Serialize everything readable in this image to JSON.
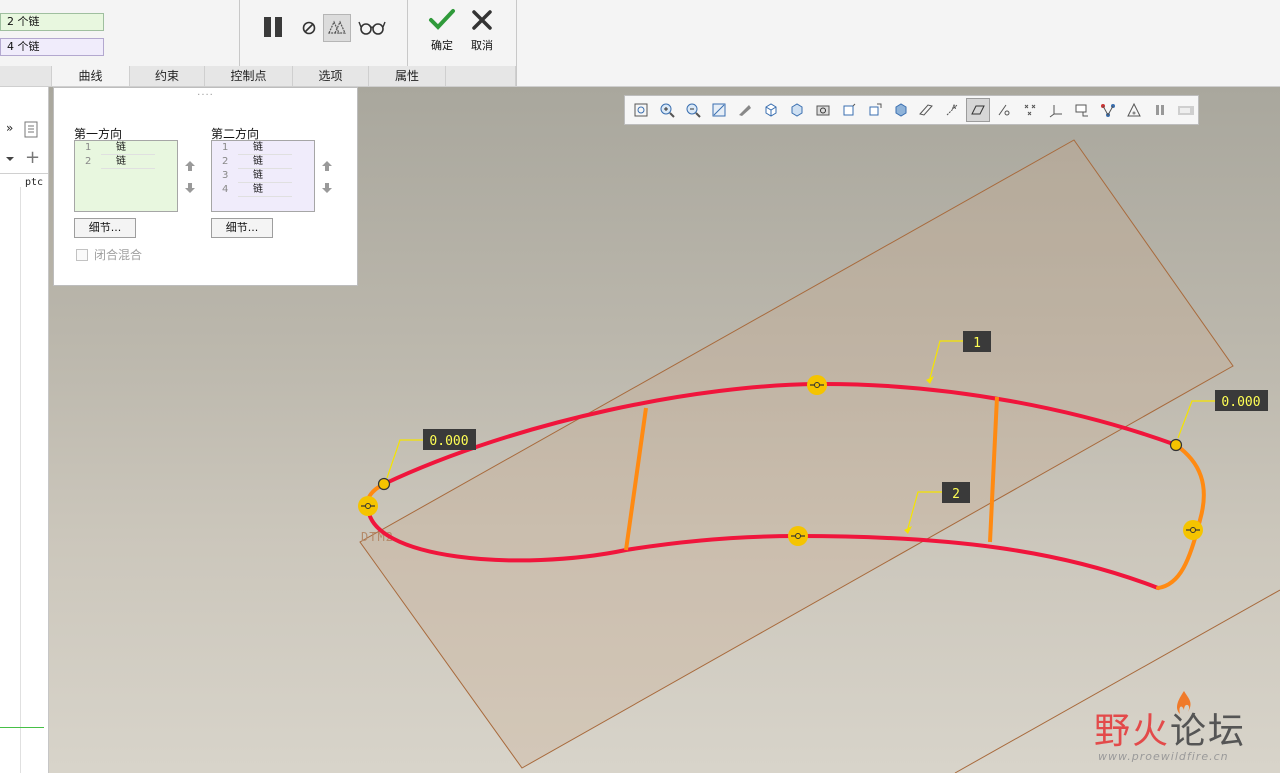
{
  "dashboard": {
    "first_direction_field": "2 个链",
    "second_direction_field": "4 个链",
    "tabs": [
      "曲线",
      "约束",
      "控制点",
      "选项",
      "属性"
    ],
    "active_tab": "曲线",
    "confirm_label": "确定",
    "cancel_label": "取消",
    "tool_icons": [
      "pause-icon",
      "stop-icon",
      "preview-geometry-icon",
      "glasses-icon"
    ]
  },
  "left_strip": {
    "chevron": "»",
    "add": "+",
    "tree_text": "ptc"
  },
  "curves_panel": {
    "handle": "....",
    "first_direction": {
      "label": "第一方向",
      "rows": [
        {
          "index": "1",
          "value": "链"
        },
        {
          "index": "2",
          "value": "链"
        }
      ],
      "details_button": "细节..."
    },
    "second_direction": {
      "label": "第二方向",
      "rows": [
        {
          "index": "1",
          "value": "链"
        },
        {
          "index": "2",
          "value": "链"
        },
        {
          "index": "3",
          "value": "链"
        },
        {
          "index": "4",
          "value": "链"
        }
      ],
      "details_button": "细节..."
    },
    "closed_blend": {
      "label": "闭合混合",
      "checked": false,
      "enabled": false
    }
  },
  "viewport": {
    "plane_label": "DTM2",
    "callouts": {
      "curve_1": "1",
      "curve_2": "2",
      "tangent_left": "0.000",
      "tangent_right": "0.000"
    },
    "colors": {
      "chain_red": "#f0153c",
      "chain_orange": "#ff8a12",
      "handle_yellow": "#f5c400",
      "callout_box": "#3a3a3a",
      "callout_text": "#ffff55",
      "plane_edge": "#a86a3c"
    }
  },
  "watermark": {
    "title_accent": "野火",
    "title_rest": "论坛",
    "url": "www.proewildfire.cn"
  }
}
